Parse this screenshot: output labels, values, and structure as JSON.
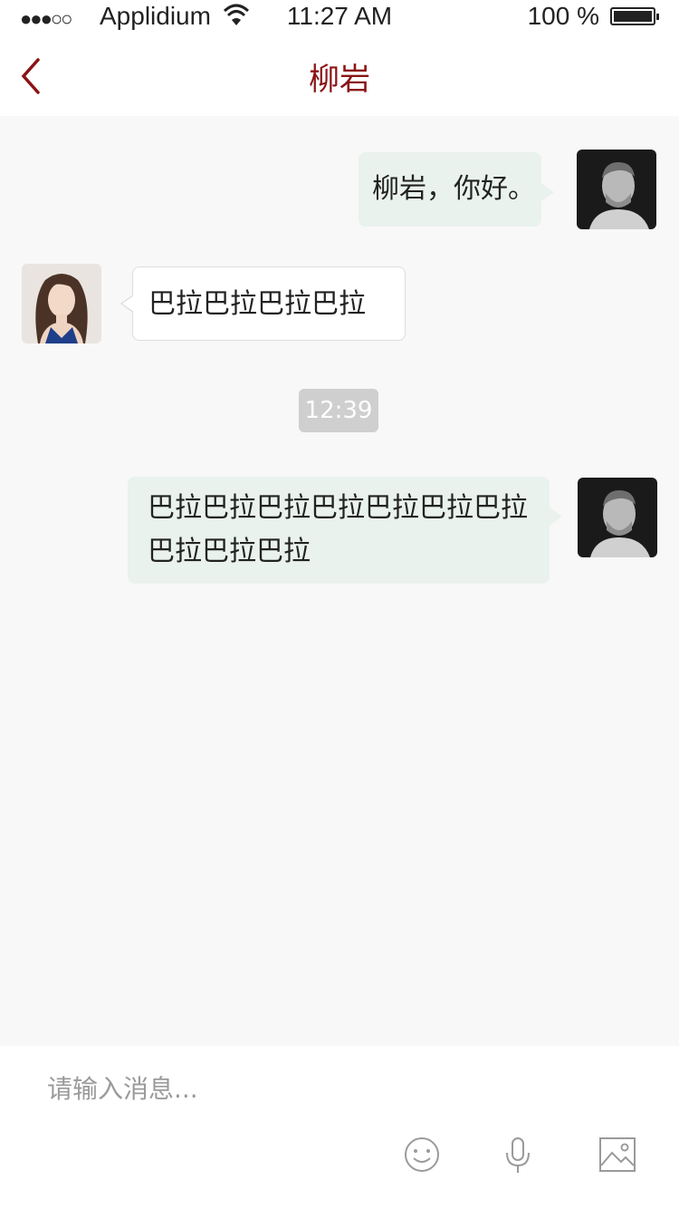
{
  "status_bar": {
    "signal": "●●●○○",
    "carrier": "Applidium",
    "time": "11:27 AM",
    "battery": "100 %"
  },
  "header": {
    "title": "柳岩"
  },
  "messages": [
    {
      "sender": "me",
      "text": "柳岩，你好。"
    },
    {
      "sender": "contact",
      "text": "巴拉巴拉巴拉巴拉"
    },
    {
      "sender": "me",
      "text": "巴拉巴拉巴拉巴拉巴拉巴拉巴拉巴拉巴拉巴拉"
    }
  ],
  "timestamp": "12:39",
  "composer": {
    "placeholder": "请输入消息..."
  },
  "colors": {
    "accent": "#8a1416",
    "my_bubble": "#e9f2ec",
    "background": "#f8f8f8"
  },
  "icons": [
    "back-chevron-icon",
    "emoji-icon",
    "microphone-icon",
    "image-icon"
  ]
}
